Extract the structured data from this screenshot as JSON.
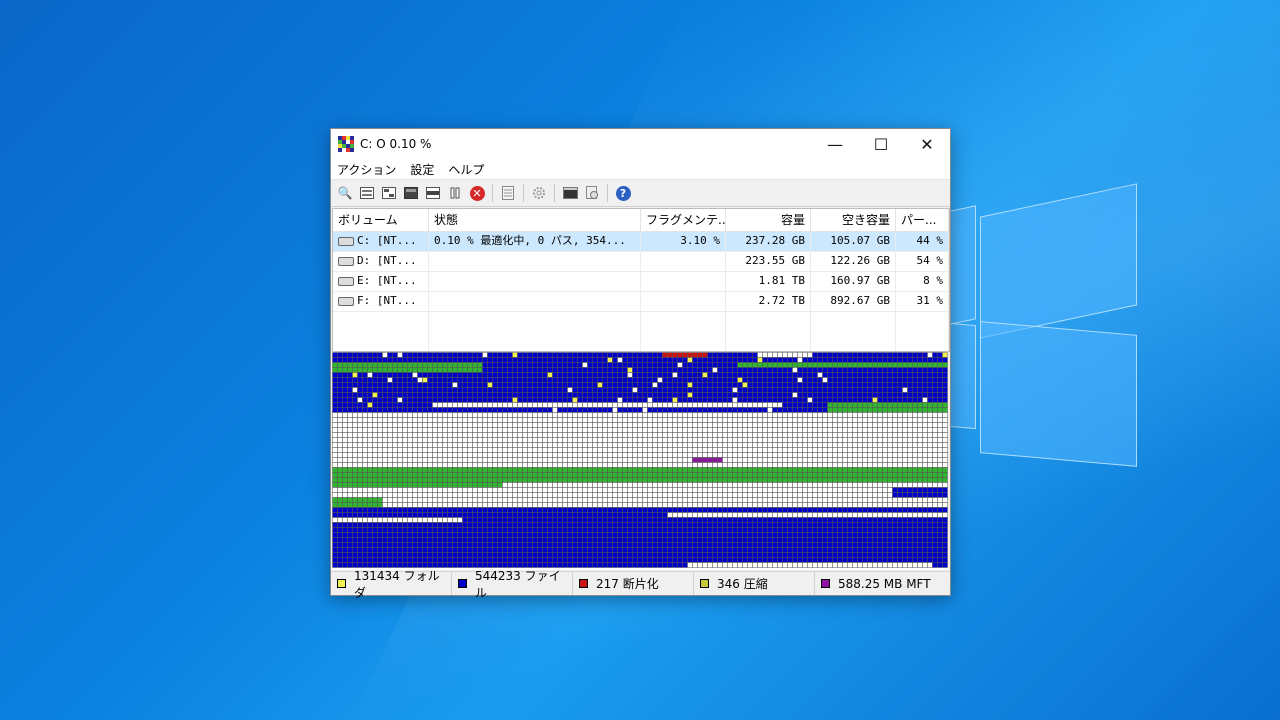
{
  "window": {
    "title": "C: O  0.10 %",
    "controls": {
      "minimize": "—",
      "maximize": "☐",
      "close": "✕"
    }
  },
  "menu": [
    "アクション",
    "設定",
    "ヘルプ"
  ],
  "toolbar_icons": [
    "search-icon",
    "analyze-icon",
    "defrag-icon",
    "quick-optimize-icon",
    "full-optimize-icon",
    "pause-icon",
    "stop-icon",
    "report-icon",
    "settings-icon",
    "console-icon",
    "boot-time-icon",
    "help-icon"
  ],
  "volumes": {
    "columns": [
      "ボリューム",
      "状態",
      "フラグメンテ...",
      "容量",
      "空き容量",
      "パー..."
    ],
    "rows": [
      {
        "volume": "C: [NT...",
        "status": "0.10 % 最適化中, 0 パス, 354...",
        "fragmentation": "3.10 %",
        "capacity": "237.28 GB",
        "free": "105.07 GB",
        "percent": "44 %",
        "selected": true
      },
      {
        "volume": "D: [NT...",
        "status": "",
        "fragmentation": "",
        "capacity": "223.55 GB",
        "free": "122.26 GB",
        "percent": "54 %",
        "selected": false
      },
      {
        "volume": "E: [NT...",
        "status": "",
        "fragmentation": "",
        "capacity": "1.81 TB",
        "free": "160.97 GB",
        "percent": "8 %",
        "selected": false
      },
      {
        "volume": "F: [NT...",
        "status": "",
        "fragmentation": "",
        "capacity": "2.72 TB",
        "free": "892.67 GB",
        "percent": "31 %",
        "selected": false
      }
    ]
  },
  "status": {
    "folders": "131434 フォルダ",
    "files": "544233 ファイル",
    "fragmented": "217 断片化",
    "compressed": "346 圧縮",
    "mft": "588.25 MB MFT"
  },
  "colors": {
    "free": "#ffffff",
    "file": "#0000c8",
    "folder": "#f0f050",
    "fragmented": "#c81414",
    "compressed": "#c8c83c",
    "mft": "#8c14a0",
    "system": "#32b432",
    "grid": "#555555"
  }
}
